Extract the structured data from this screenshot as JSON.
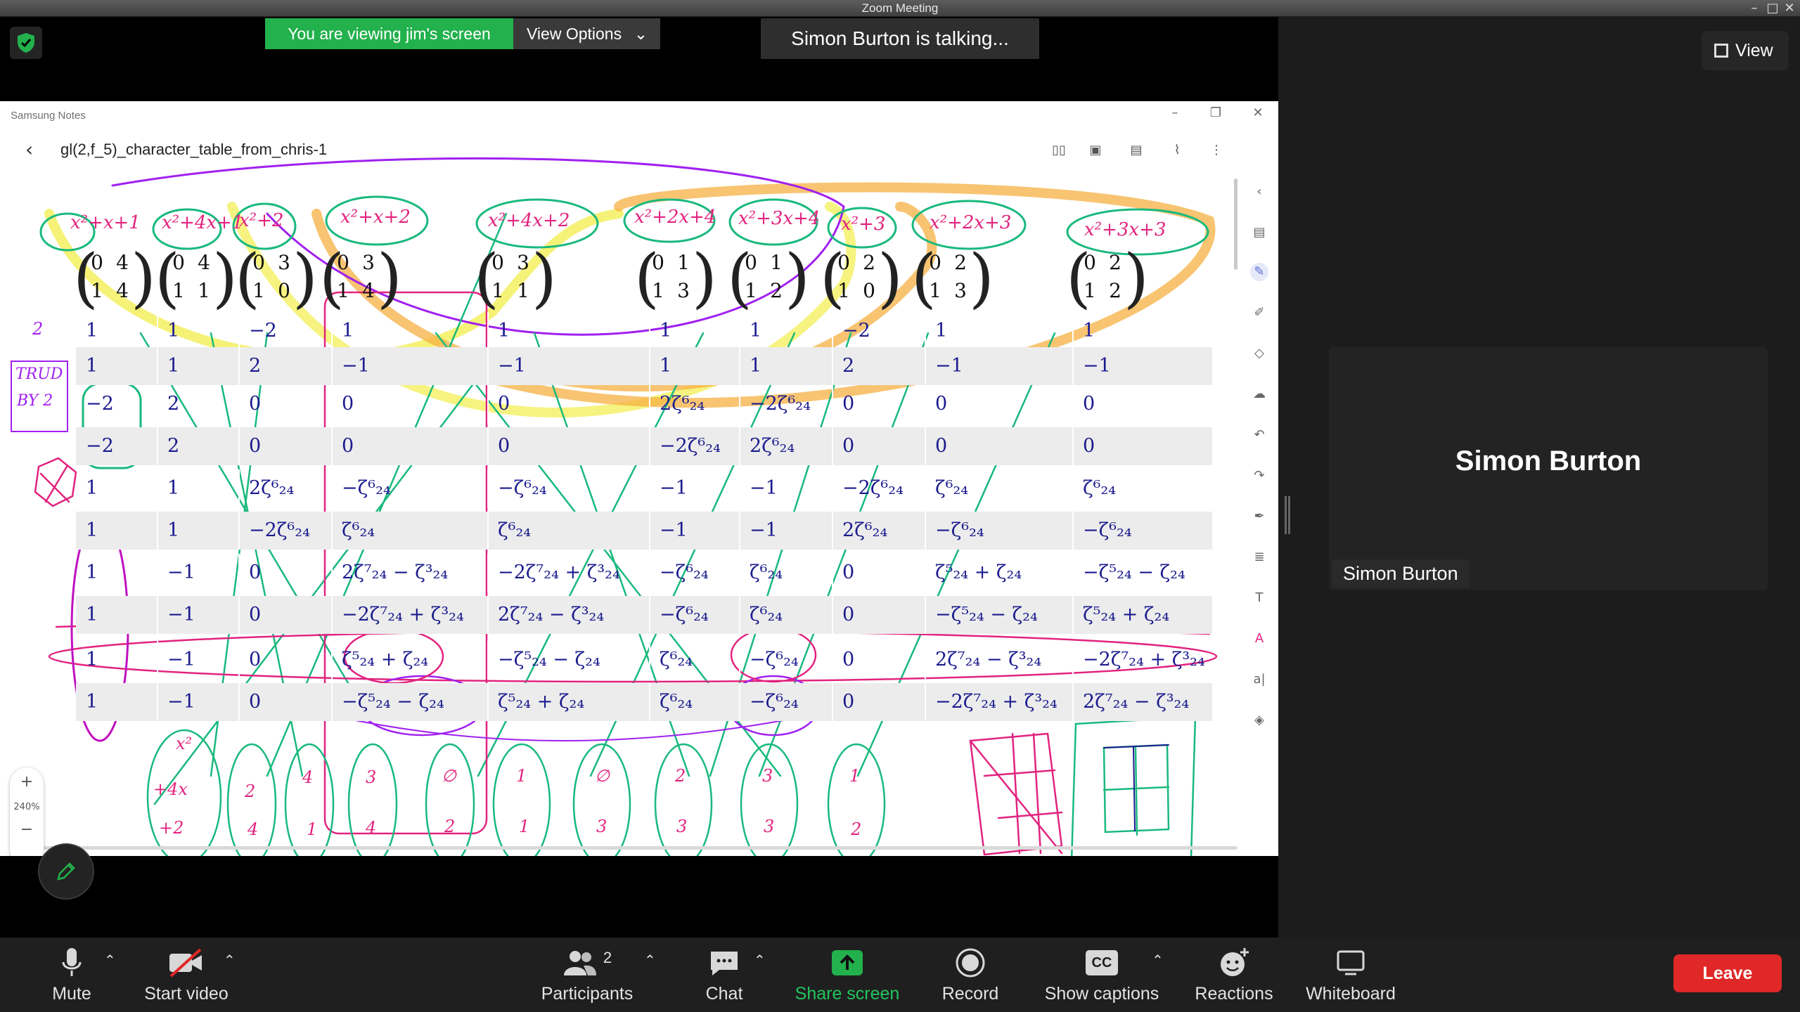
{
  "window": {
    "title": "Zoom Meeting"
  },
  "banner": {
    "viewing": "You are viewing jim's screen",
    "view_options": "View Options",
    "talking": "Simon Burton is talking...",
    "view": "View"
  },
  "notes_app": {
    "app_name": "Samsung Notes",
    "document_title": "gl(2,f_5)_character_table_from_chris-1",
    "zoom_level": "240%",
    "zoom_in": "+",
    "zoom_out": "−"
  },
  "handwritten_polys": [
    "x²+x+1",
    "x²+4x+1",
    "x²+2",
    "x²+x+2",
    "x²+4x+2",
    "x²+2x+4",
    "x²+3x+4",
    "x²+3",
    "x²+2x+3",
    "x²+3x+3"
  ],
  "column_matrices": [
    [
      "0",
      "4",
      "1",
      "4"
    ],
    [
      "0",
      "4",
      "1",
      "1"
    ],
    [
      "0",
      "3",
      "1",
      "0"
    ],
    [
      "0",
      "3",
      "1",
      "4"
    ],
    [
      "0",
      "3",
      "1",
      "1"
    ],
    [
      "0",
      "1",
      "1",
      "3"
    ],
    [
      "0",
      "1",
      "1",
      "2"
    ],
    [
      "0",
      "2",
      "1",
      "0"
    ],
    [
      "0",
      "2",
      "1",
      "3"
    ],
    [
      "0",
      "2",
      "1",
      "2"
    ]
  ],
  "character_table": [
    [
      "1",
      "1",
      "−2",
      "1",
      "1",
      "1",
      "1",
      "−2",
      "1",
      "1"
    ],
    [
      "1",
      "1",
      "2",
      "−1",
      "−1",
      "1",
      "1",
      "2",
      "−1",
      "−1"
    ],
    [
      "−2",
      "2",
      "0",
      "0",
      "0",
      "2ζ⁶₂₄",
      "−2ζ⁶₂₄",
      "0",
      "0",
      "0"
    ],
    [
      "−2",
      "2",
      "0",
      "0",
      "0",
      "−2ζ⁶₂₄",
      "2ζ⁶₂₄",
      "0",
      "0",
      "0"
    ],
    [
      "1",
      "1",
      "2ζ⁶₂₄",
      "−ζ⁶₂₄",
      "−ζ⁶₂₄",
      "−1",
      "−1",
      "−2ζ⁶₂₄",
      "ζ⁶₂₄",
      "ζ⁶₂₄"
    ],
    [
      "1",
      "1",
      "−2ζ⁶₂₄",
      "ζ⁶₂₄",
      "ζ⁶₂₄",
      "−1",
      "−1",
      "2ζ⁶₂₄",
      "−ζ⁶₂₄",
      "−ζ⁶₂₄"
    ],
    [
      "1",
      "−1",
      "0",
      "2ζ⁷₂₄ − ζ³₂₄",
      "−2ζ⁷₂₄ + ζ³₂₄",
      "−ζ⁶₂₄",
      "ζ⁶₂₄",
      "0",
      "ζ⁵₂₄ + ζ₂₄",
      "−ζ⁵₂₄ − ζ₂₄"
    ],
    [
      "1",
      "−1",
      "0",
      "−2ζ⁷₂₄ + ζ³₂₄",
      "2ζ⁷₂₄ − ζ³₂₄",
      "−ζ⁶₂₄",
      "ζ⁶₂₄",
      "0",
      "−ζ⁵₂₄ − ζ₂₄",
      "ζ⁵₂₄ + ζ₂₄"
    ],
    [
      "1",
      "−1",
      "0",
      "ζ⁵₂₄ + ζ₂₄",
      "−ζ⁵₂₄ − ζ₂₄",
      "ζ⁶₂₄",
      "−ζ⁶₂₄",
      "0",
      "2ζ⁷₂₄ − ζ³₂₄",
      "−2ζ⁷₂₄ + ζ³₂₄"
    ],
    [
      "1",
      "−1",
      "0",
      "−ζ⁵₂₄ − ζ₂₄",
      "ζ⁵₂₄ + ζ₂₄",
      "ζ⁶₂₄",
      "−ζ⁶₂₄",
      "0",
      "−2ζ⁷₂₄ + ζ³₂₄",
      "2ζ⁷₂₄ − ζ³₂₄"
    ]
  ],
  "handwritten_notes": {
    "left": [
      "2",
      "TRUD",
      "BY 2"
    ],
    "bottom": [
      "x²",
      "+4x",
      "+2",
      "2",
      "4",
      "4",
      "1",
      "3",
      "4",
      "∅",
      "2",
      "1",
      "1",
      "∅",
      "3",
      "2",
      "3",
      "3",
      "3",
      "1",
      "2"
    ]
  },
  "participant": {
    "name": "Simon Burton",
    "label": "Simon Burton"
  },
  "toolbar": {
    "mute": "Mute",
    "start_video": "Start video",
    "participants": "Participants",
    "participants_count": "2",
    "chat": "Chat",
    "share_screen": "Share screen",
    "record": "Record",
    "show_captions": "Show captions",
    "captions_badge": "CC",
    "reactions": "Reactions",
    "whiteboard": "Whiteboard",
    "leave": "Leave"
  },
  "colors": {
    "share_green": "#22b14c",
    "leave_red": "#e02828",
    "ink_blue": "#1b1b8f",
    "marker_yellow": "#f2ee4a",
    "marker_orange": "#f5b041",
    "ink_pink": "#e2237f",
    "ink_green": "#19b97d",
    "ink_purple": "#a020f0"
  }
}
